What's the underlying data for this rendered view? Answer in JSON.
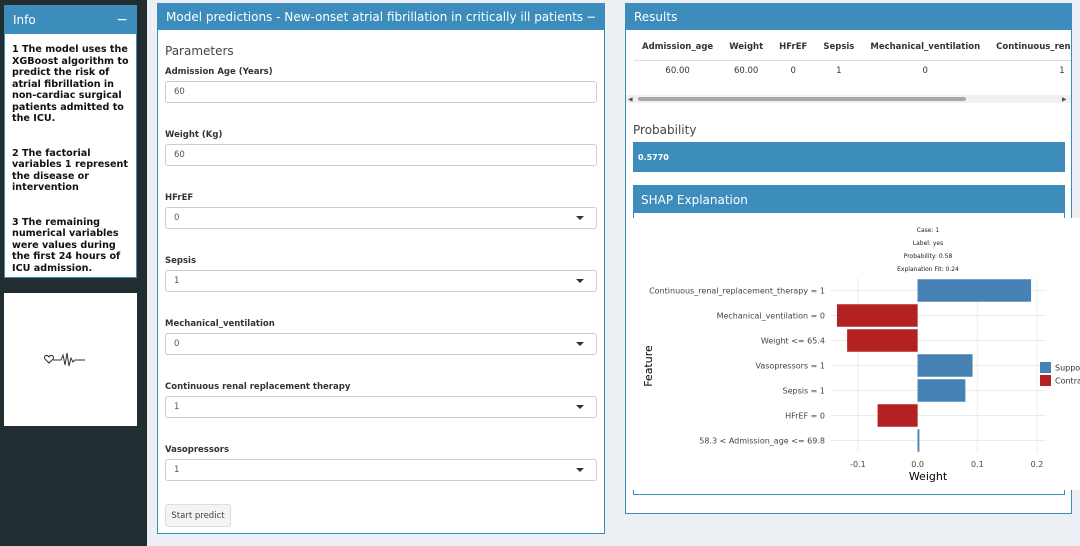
{
  "info": {
    "title": "Info",
    "collapse": "−",
    "notes": [
      "1 The model uses the XGBoost algorithm to predict the risk of atrial fibrillation in non-cardiac surgical patients admitted to the ICU.",
      "2 The factorial variables 1 represent the disease or intervention",
      "3 The remaining numerical variables were values during the first 24 hours of ICU admission."
    ]
  },
  "model": {
    "title": "Model predictions - New-onset atrial fibrillation in critically ill patients",
    "collapse": "−",
    "params_title": "Parameters",
    "fields": [
      {
        "label": "Admission Age (Years)",
        "value": "60",
        "type": "text"
      },
      {
        "label": "Weight (Kg)",
        "value": "60",
        "type": "text"
      },
      {
        "label": "HFrEF",
        "value": "0",
        "type": "select"
      },
      {
        "label": "Sepsis",
        "value": "1",
        "type": "select"
      },
      {
        "label": "Mechanical_ventilation",
        "value": "0",
        "type": "select"
      },
      {
        "label": "Continuous renal replacement therapy",
        "value": "1",
        "type": "select"
      },
      {
        "label": "Vasopressors",
        "value": "1",
        "type": "select"
      }
    ],
    "start_button": "Start predict"
  },
  "results": {
    "title": "Results",
    "columns": [
      "Admission_age",
      "Weight",
      "HFrEF",
      "Sepsis",
      "Mechanical_ventilation",
      "Continuous_renal_replacem"
    ],
    "row": [
      "60.00",
      "60.00",
      "0",
      "1",
      "0",
      "1"
    ],
    "probability_title": "Probability",
    "probability": "0.5770",
    "shap_title": "SHAP Explanation"
  },
  "chart_data": {
    "type": "bar",
    "orientation": "horizontal",
    "header_lines": [
      "Case: 1",
      "Label: yes",
      "Probability: 0.58",
      "Explanation Fit: 0.24"
    ],
    "categories": [
      "Continuous_renal_replacement_therapy = 1",
      "Mechanical_ventilation = 0",
      "Weight <= 65.4",
      "Vasopressors = 1",
      "Sepsis = 1",
      "HFrEF = 0",
      "58.3 < Admission_age <= 69.8"
    ],
    "values": [
      0.19,
      -0.135,
      -0.118,
      0.092,
      0.08,
      -0.067,
      0.003
    ],
    "xlabel": "Weight",
    "ylabel": "Feature",
    "xlim": [
      -0.145,
      0.215
    ],
    "xticks": [
      -0.1,
      0.0,
      0.1,
      0.2
    ],
    "xtick_labels": [
      "-0.1",
      "0.0",
      "0.1",
      "0.2"
    ],
    "legend": [
      {
        "label": "Supports",
        "color": "#4682b4"
      },
      {
        "label": "Contradicts",
        "color": "#b22222"
      }
    ],
    "colors": {
      "supports": "#4682b4",
      "contradicts": "#b22222"
    },
    "grid": true
  }
}
